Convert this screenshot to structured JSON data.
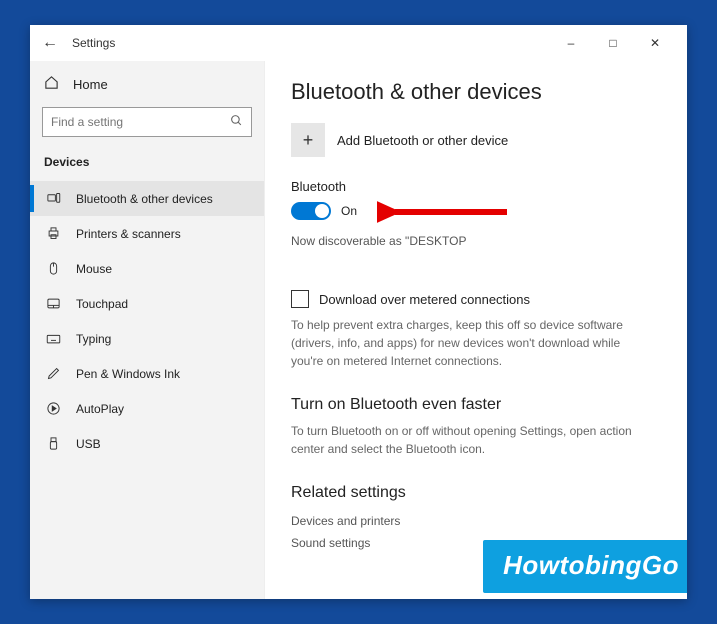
{
  "window": {
    "title": "Settings"
  },
  "sidebar": {
    "home": "Home",
    "search_placeholder": "Find a setting",
    "section": "Devices",
    "items": [
      {
        "label": "Bluetooth & other devices"
      },
      {
        "label": "Printers & scanners"
      },
      {
        "label": "Mouse"
      },
      {
        "label": "Touchpad"
      },
      {
        "label": "Typing"
      },
      {
        "label": "Pen & Windows Ink"
      },
      {
        "label": "AutoPlay"
      },
      {
        "label": "USB"
      }
    ]
  },
  "main": {
    "title": "Bluetooth & other devices",
    "add_label": "Add Bluetooth or other device",
    "bt_label": "Bluetooth",
    "bt_state": "On",
    "discover": "Now discoverable as \"DESKTOP",
    "metered_label": "Download over metered connections",
    "metered_desc": "To help prevent extra charges, keep this off so device software (drivers, info, and apps) for new devices won't download while you're on metered Internet connections.",
    "faster_head": "Turn on Bluetooth even faster",
    "faster_desc": "To turn Bluetooth on or off without opening Settings, open action center and select the Bluetooth icon.",
    "related_head": "Related settings",
    "link1": "Devices and printers",
    "link2": "Sound settings"
  },
  "watermark": "HowtobingGo"
}
